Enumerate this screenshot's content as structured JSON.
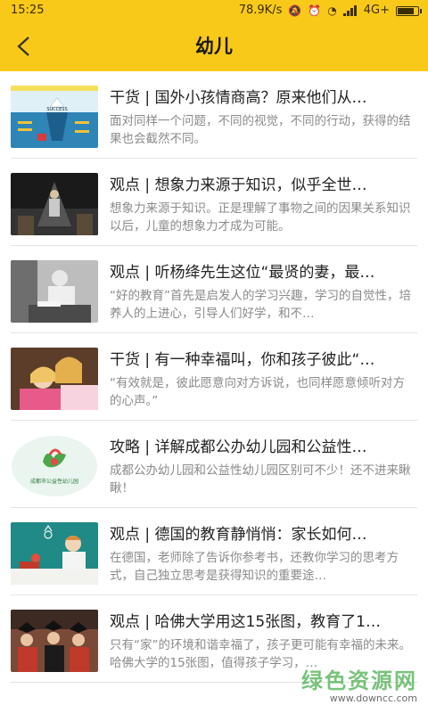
{
  "statusbar": {
    "time": "15:25",
    "speed": "78.9K/s",
    "network": "4G+",
    "battery_percent": 90
  },
  "header": {
    "title": "幼儿"
  },
  "articles": [
    {
      "title": "干货 | 国外小孩情商高？原来他们从…",
      "desc": "面对同样一个问题，不同的视觉，不同的行动，获得的结果也会截然不同。"
    },
    {
      "title": "观点 | 想象力来源于知识，似乎全世…",
      "desc": "想象力来源于知识。正是理解了事物之间的因果关系知识以后，儿童的想象力才成为可能。"
    },
    {
      "title": "观点 | 听杨绛先生这位“最贤的妻，最…",
      "desc": "“好的教育”首先是启发人的学习兴趣，学习的自觉性，培养人的上进心，引导人们好学，和不…"
    },
    {
      "title": "干货 | 有一种幸福叫，你和孩子彼此“…",
      "desc": "“有效就是，彼此愿意向对方诉说，也同样愿意倾听对方的心声。”"
    },
    {
      "title": "攻略 | 详解成都公办幼儿园和公益性…",
      "desc": "成都公办幼儿园和公益性幼儿园区别可不少！还不进来瞅瞅！"
    },
    {
      "title": "观点 | 德国的教育静悄悄：家长如何…",
      "desc": "在德国，老师除了告诉你参考书，还教你学习的思考方式，自己独立思考是获得知识的重要途…"
    },
    {
      "title": "观点 | 哈佛大学用这15张图，教育了1…",
      "desc": "只有“家”的环境和谐幸福了，孩子更可能有幸福的未来。哈佛大学的15张图，值得孩子学习，…"
    }
  ],
  "thumb_text": {
    "t1_success": "SUCCESS",
    "t5_logo_text": "成都市公益性幼儿园"
  },
  "watermark": {
    "title": "绿色资源网",
    "url": "www.downcc.com"
  },
  "colors": {
    "accent": "#f9c91a",
    "title_text": "#222222",
    "desc_text": "#8a8a8a"
  }
}
